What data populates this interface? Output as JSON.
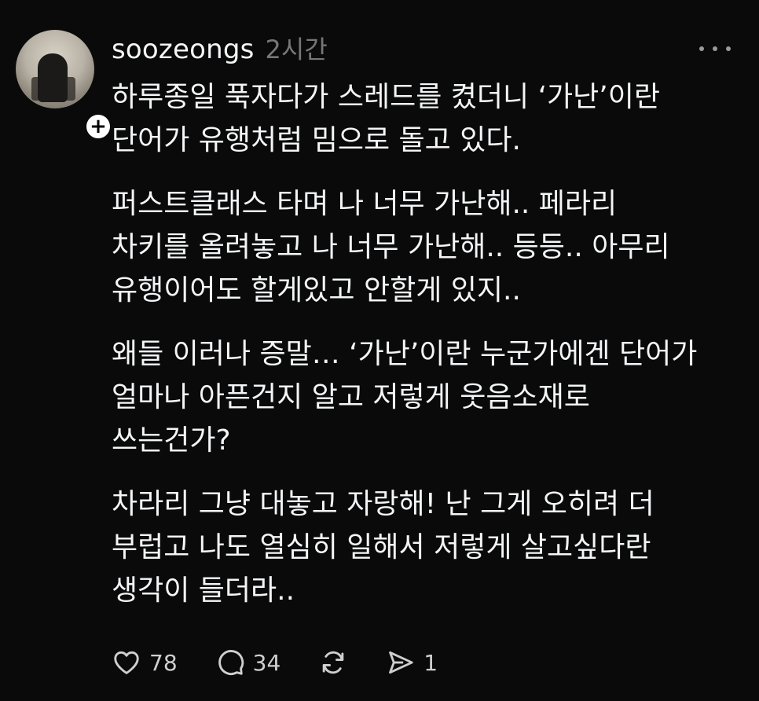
{
  "post": {
    "username": "soozeongs",
    "timestamp": "2시간",
    "follow_symbol": "+",
    "paragraphs": [
      {
        "lines": [
          "하루종일 푹자다가 스레드를 켰더니 ‘가난’이란",
          "단어가 유행처럼 밈으로 돌고 있다."
        ]
      },
      {
        "lines": [
          "퍼스트클래스 타며 나 너무 가난해.. 페라리",
          "차키를 올려놓고 나 너무 가난해.. 등등.. 아무리",
          "유행이어도 할게있고 안할게 있지.."
        ]
      },
      {
        "lines": [
          "왜들 이러나 증말… ‘가난’이란 누군가에겐 단어가",
          "얼마나 아픈건지 알고 저렇게 웃음소재로",
          "쓰는건가?"
        ]
      },
      {
        "lines": [
          "차라리 그냥 대놓고 자랑해! 난 그게 오히려 더",
          "부럽고 나도 열심히 일해서 저렇게 살고싶다란",
          "생각이 들더라.."
        ]
      }
    ],
    "actions": {
      "like": {
        "icon": "heart-icon",
        "count": "78"
      },
      "comment": {
        "icon": "comment-icon",
        "count": "34"
      },
      "repost": {
        "icon": "repost-icon"
      },
      "share": {
        "icon": "send-icon",
        "count": "1"
      }
    }
  },
  "colors": {
    "background": "#0a0a0a",
    "text": "#f3f5f7",
    "muted": "#777777",
    "icon": "#cfcfcf"
  }
}
